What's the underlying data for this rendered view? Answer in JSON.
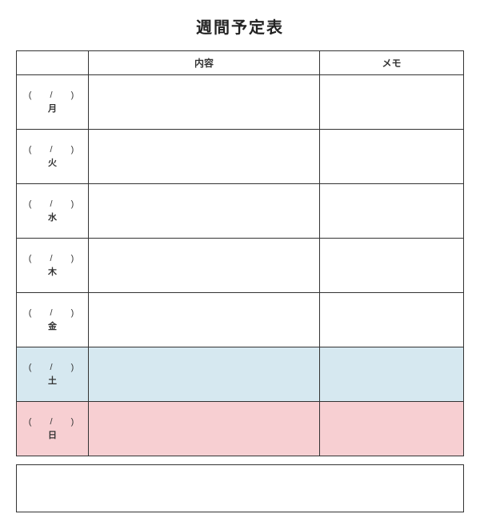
{
  "title": "週間予定表",
  "headers": {
    "day": "",
    "content": "内容",
    "memo": "メモ"
  },
  "date_placeholder": "(　 /　 )",
  "rows": [
    {
      "weekday": "月",
      "row_class": "",
      "content": "",
      "memo": ""
    },
    {
      "weekday": "火",
      "row_class": "",
      "content": "",
      "memo": ""
    },
    {
      "weekday": "水",
      "row_class": "",
      "content": "",
      "memo": ""
    },
    {
      "weekday": "木",
      "row_class": "",
      "content": "",
      "memo": ""
    },
    {
      "weekday": "金",
      "row_class": "",
      "content": "",
      "memo": ""
    },
    {
      "weekday": "土",
      "row_class": "sat",
      "content": "",
      "memo": ""
    },
    {
      "weekday": "日",
      "row_class": "sun",
      "content": "",
      "memo": ""
    }
  ],
  "notes": ""
}
